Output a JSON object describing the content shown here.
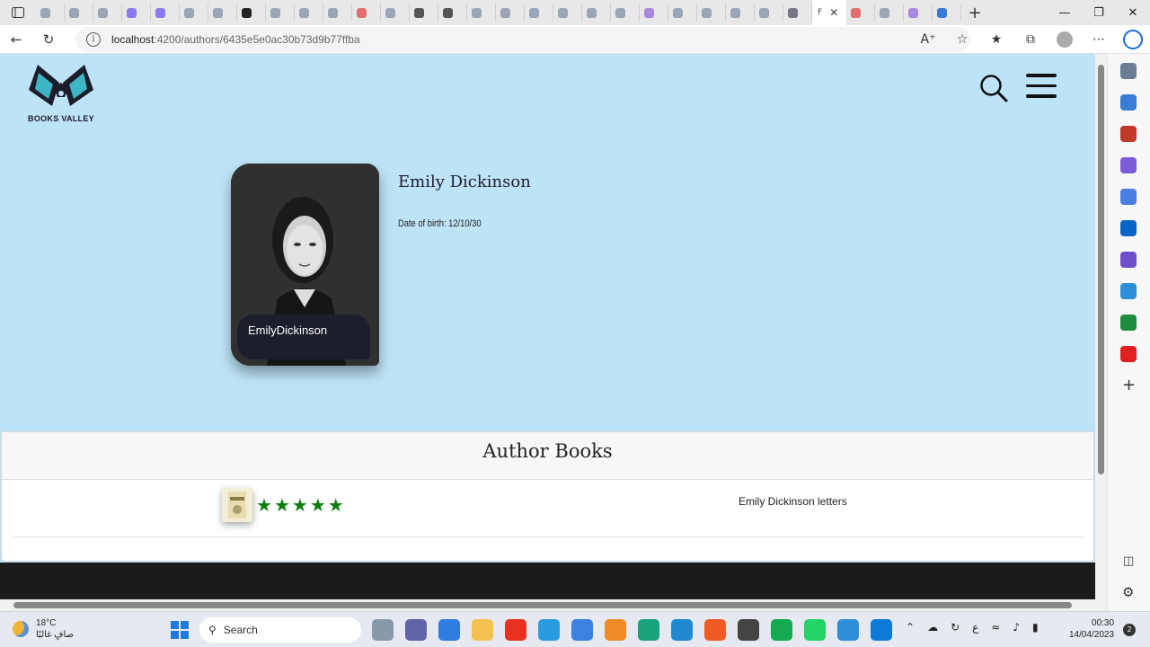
{
  "browser": {
    "url_host": "localhost",
    "url_rest": ":4200/authors/6435e5e0ac30b73d9b77ffba",
    "active_tab_label": "F",
    "close_glyph": "✕",
    "new_tab_glyph": "+"
  },
  "page": {
    "brand": "BOOKS VALLEY",
    "author_card_name": "EmilyDickinson",
    "author_title": "Emily Dickinson",
    "date_of_birth": "Date of birth: 12/10/30",
    "books_heading": "Author Books",
    "books": [
      {
        "title": "Emily Dickinson letters",
        "rating": 5
      }
    ]
  },
  "taskbar": {
    "temperature": "18°C",
    "weather_text": "صافٍ غالبًا",
    "search_label": "Search",
    "time": "00:30",
    "date": "14/04/2023",
    "notification_count": "2",
    "tray_lang": "ع"
  },
  "colors": {
    "page_bg": "#bde3f6",
    "star": "#0a7f0a",
    "footer": "#1b1b1b",
    "card_plate": "#1d1e2c"
  }
}
